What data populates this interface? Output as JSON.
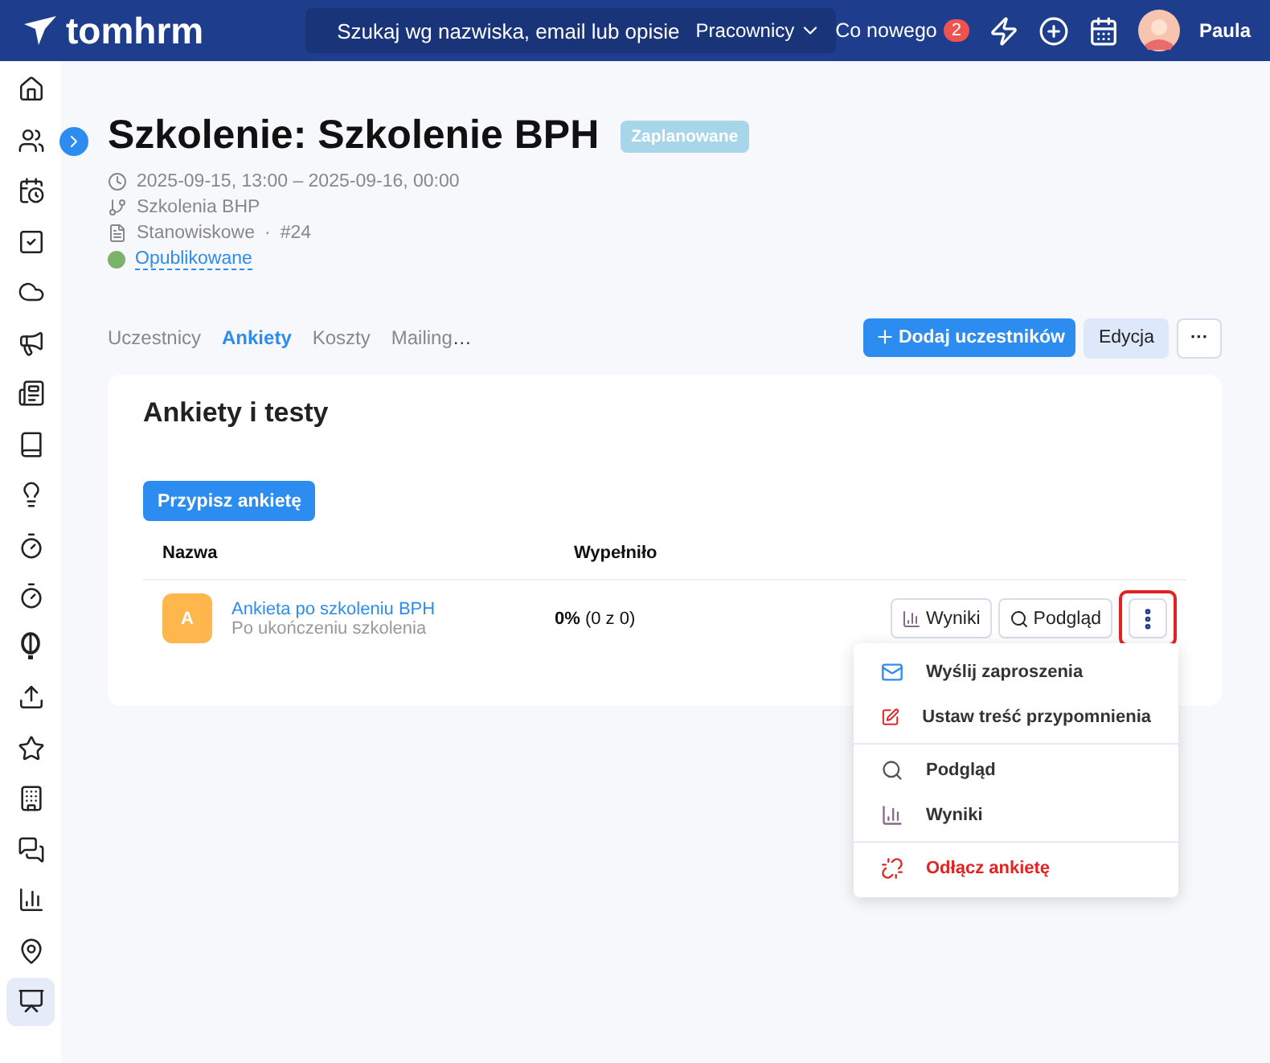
{
  "header": {
    "logo": "tomhrm",
    "search_placeholder": "Szukaj wg nazwiska, email lub opisie",
    "scope": "Pracownicy",
    "whats_new": "Co nowego",
    "whats_new_count": "2",
    "user": "Paula"
  },
  "sidebar": {
    "items": [
      {
        "selected": false
      },
      {
        "selected": false
      },
      {
        "selected": false
      },
      {
        "selected": false
      },
      {
        "selected": false
      },
      {
        "selected": false
      },
      {
        "selected": false
      },
      {
        "selected": false
      },
      {
        "selected": false
      },
      {
        "selected": false
      },
      {
        "selected": false
      },
      {
        "selected": false
      },
      {
        "selected": false
      },
      {
        "selected": false
      },
      {
        "selected": false
      },
      {
        "selected": false
      },
      {
        "selected": false
      },
      {
        "selected": false
      },
      {
        "selected": true
      }
    ]
  },
  "page": {
    "title": "Szkolenie: Szkolenie BPH",
    "status": "Zaplanowane",
    "date_range": "2025-09-15, 13:00 – 2025-09-16, 00:00",
    "category": "Szkolenia BHP",
    "type": "Stanowiskowe",
    "separator": "·",
    "number": "#24",
    "publication": {
      "label": "Opublikowane",
      "color": "#7cb36b"
    }
  },
  "tabs": [
    {
      "label": "Uczestnicy",
      "selected": false
    },
    {
      "label": "Ankiety",
      "selected": true
    },
    {
      "label": "Koszty",
      "selected": false
    },
    {
      "label": "Mailing",
      "selected": false
    }
  ],
  "tabs_more": "…",
  "actions": {
    "add": "Dodaj uczestników",
    "edit": "Edycja",
    "more": "···"
  },
  "card": {
    "title": "Ankiety i testy",
    "assign_button": "Przypisz ankietę",
    "columns": [
      "Nazwa",
      "Wypełniło"
    ],
    "rows": [
      {
        "avatar": "A",
        "color": "#ffb74d",
        "name": "Ankieta po szkoleniu BPH",
        "subtitle": "Po ukończeniu szkolenia",
        "filled": "0%",
        "filled_detail": "(0 z 0)",
        "results_button": "Wyniki",
        "preview_button": "Podgląd",
        "menu_open": true
      }
    ]
  },
  "menu": {
    "groups": [
      [
        {
          "kind": "mail",
          "label": "Wyślij zaproszenia",
          "danger": false
        },
        {
          "kind": "edit",
          "label": "Ustaw treść przypomnienia",
          "danger": false
        }
      ],
      [
        {
          "kind": "search",
          "label": "Podgląd",
          "danger": false
        },
        {
          "kind": "chart",
          "label": "Wyniki",
          "danger": false
        }
      ],
      [
        {
          "kind": "unlink",
          "label": "Odłącz ankietę",
          "danger": true
        }
      ]
    ]
  }
}
